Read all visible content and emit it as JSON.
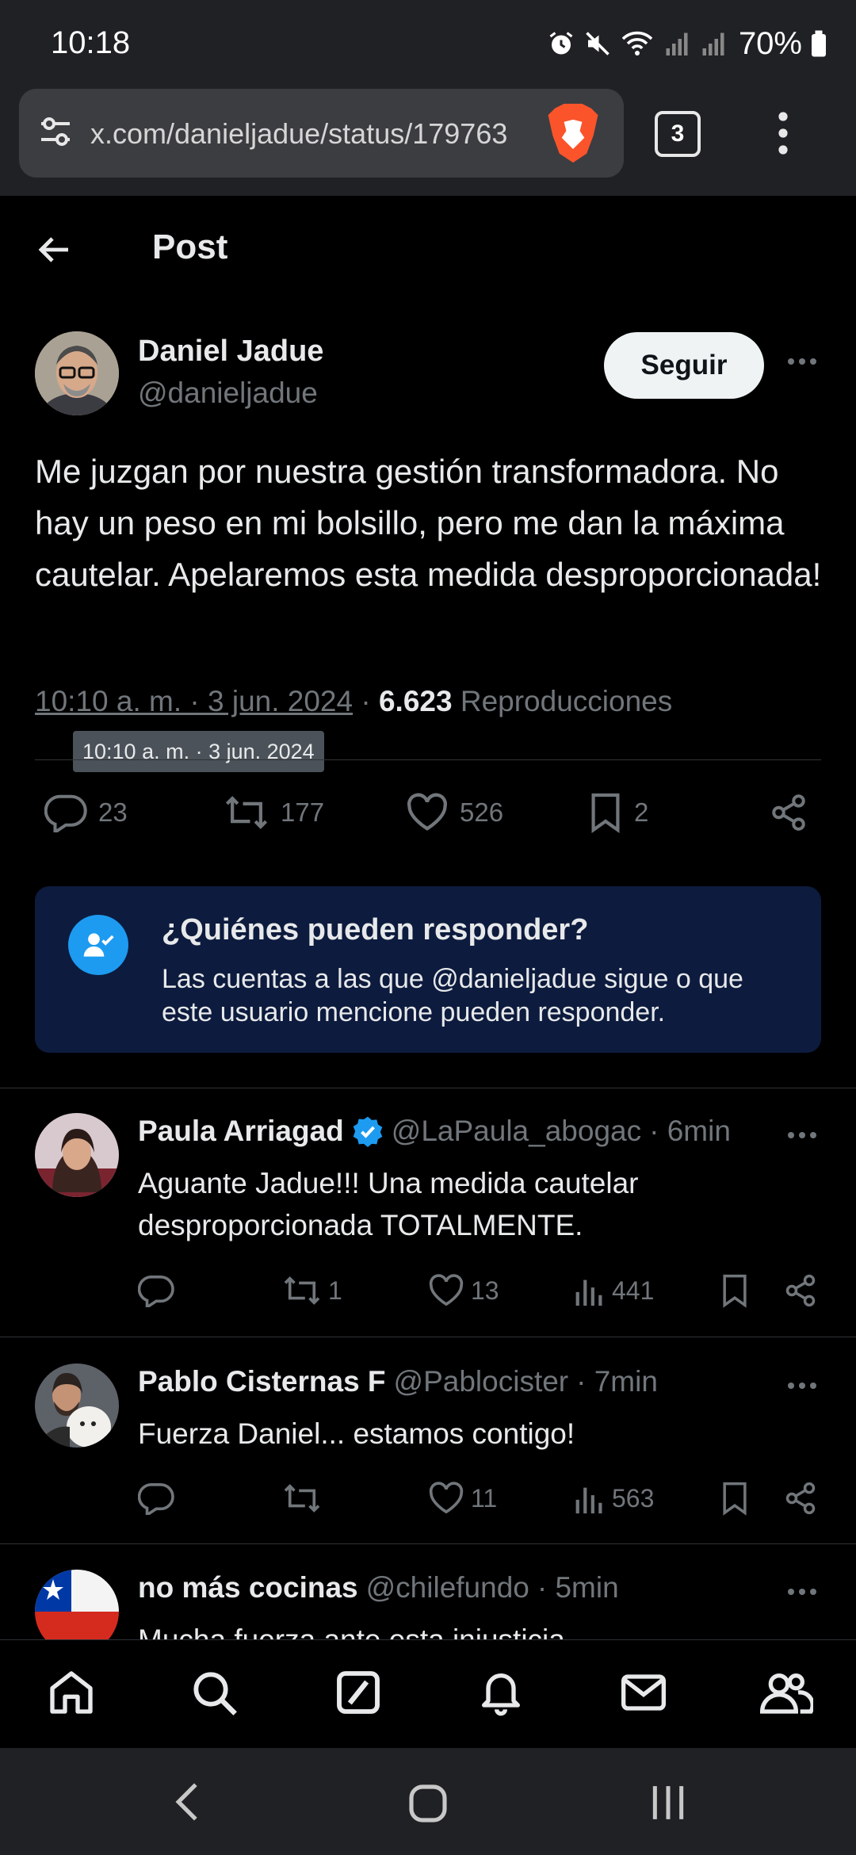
{
  "status_bar": {
    "time": "10:18",
    "battery": "70%"
  },
  "browser": {
    "url": "x.com/danieljadue/status/179763",
    "tab_count": "3"
  },
  "header": {
    "title": "Post"
  },
  "post": {
    "author_name": "Daniel Jadue",
    "author_handle": "@danieljadue",
    "follow_label": "Seguir",
    "text": "Me juzgan por nuestra gestión transformadora. No hay un peso en mi bolsillo, pero me dan la máxima cautelar. Apelaremos esta medida desproporcionada!",
    "timestamp": "10:10 a. m. · 3 jun. 2024",
    "separator": "·",
    "views": "6.623",
    "views_label": "Reproducciones",
    "tooltip": "10:10 a. m. · 3 jun. 2024",
    "stats": {
      "replies": "23",
      "reposts": "177",
      "likes": "526",
      "bookmarks": "2"
    }
  },
  "reply_restriction": {
    "title": "¿Quiénes pueden responder?",
    "body": "Las cuentas a las que @danieljadue sigue o que este usuario mencione pueden responder."
  },
  "replies": [
    {
      "name": "Paula Arriagad",
      "handle": "@LaPaula_abogac",
      "time": "· 6min",
      "verified": true,
      "text": "Aguante Jadue!!! Una medida cautelar desproporcionada TOTALMENTE.",
      "reposts": "1",
      "likes": "13",
      "views": "441"
    },
    {
      "name": "Pablo Cisternas F",
      "handle": "@Pablocister",
      "time": "· 7min",
      "verified": false,
      "text": "Fuerza Daniel... estamos contigo!",
      "reposts": "",
      "likes": "11",
      "views": "563"
    },
    {
      "name": "no más cocinas",
      "handle": "@chilefundo",
      "time": "· 5min",
      "verified": false,
      "text": "Mucha fuerza ante esta injusticia",
      "reposts": "",
      "likes": "",
      "views": ""
    }
  ],
  "colors": {
    "accent": "#1d9bf0",
    "background": "#000000",
    "muted": "#71767b",
    "card": "#0d1b3e"
  },
  "icons": {
    "status": [
      "alarm-icon",
      "mute-icon",
      "wifi-icon",
      "signal-icon",
      "battery-icon"
    ],
    "nav": [
      "home-icon",
      "search-icon",
      "grok-icon",
      "notifications-icon",
      "messages-icon",
      "communities-icon"
    ]
  }
}
